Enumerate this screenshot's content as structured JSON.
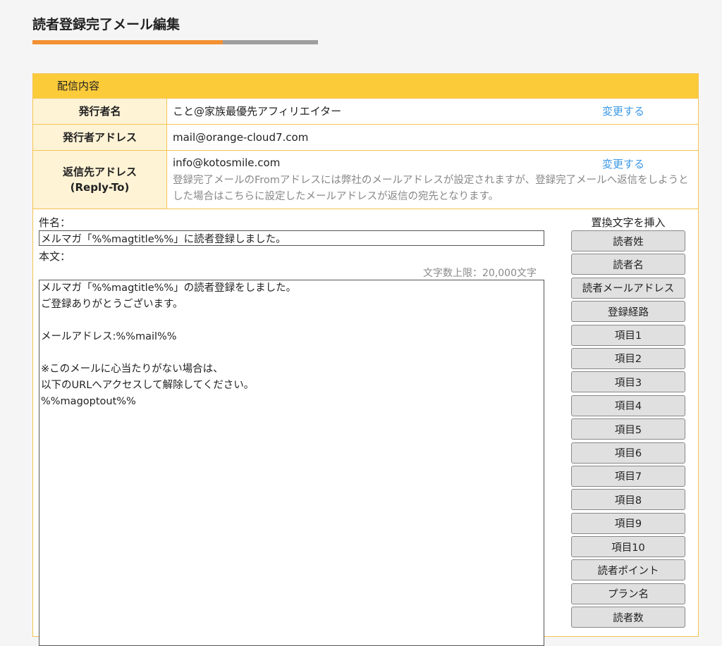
{
  "page": {
    "title": "読者登録完了メール編集"
  },
  "colors": {
    "accent": "#f39132",
    "header": "#fccb3a",
    "label_bg": "#fff3d6",
    "link": "#3a98e6"
  },
  "panel": {
    "header": "配信内容",
    "sender_name": {
      "label": "発行者名",
      "value": "こと@家族最優先アフィリエイター",
      "change": "変更する"
    },
    "sender_address": {
      "label": "発行者アドレス",
      "value": "mail@orange-cloud7.com"
    },
    "reply_to": {
      "label_line1": "返信先アドレス",
      "label_line2": "(Reply-To)",
      "value": "info@kotosmile.com",
      "change": "変更する",
      "note": "登録完了メールのFromアドレスには弊社のメールアドレスが設定されますが、登録完了メールへ返信をしようとした場合はこちらに設定したメールアドレスが返信の宛先となります。"
    }
  },
  "editor": {
    "subject_label": "件名：",
    "subject_value": "メルマガ「%%magtitle%%」に読者登録しました。",
    "body_label": "本文：",
    "char_limit": "文字数上限：20,000文字",
    "body_value": "メルマガ「%%magtitle%%」の読者登録をしました。\nご登録ありがとうございます。\n\nメールアドレス:%%mail%%\n\n※このメールに心当たりがない場合は、\n以下のURLへアクセスして解除してください。\n%%magoptout%%"
  },
  "insert": {
    "title": "置換文字を挿入",
    "buttons": [
      "読者姓",
      "読者名",
      "読者メールアドレス",
      "登録経路",
      "項目1",
      "項目2",
      "項目3",
      "項目4",
      "項目5",
      "項目6",
      "項目7",
      "項目8",
      "項目9",
      "項目10",
      "読者ポイント",
      "プラン名",
      "読者数"
    ]
  }
}
